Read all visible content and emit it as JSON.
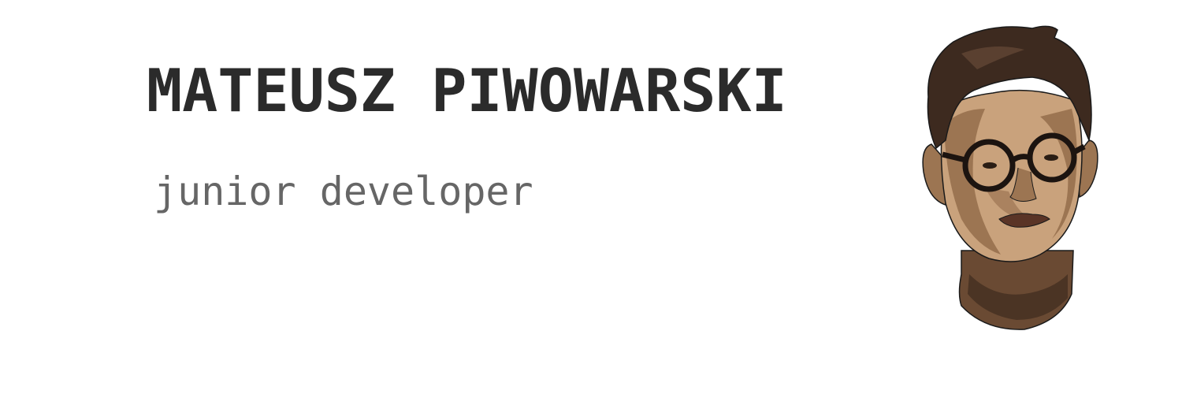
{
  "header": {
    "name": "MATEUSZ PIWOWARSKI",
    "role": "junior developer"
  },
  "portrait": {
    "icon": "person-portrait-illustration"
  },
  "colors": {
    "name_text": "#2b2b2b",
    "role_text": "#666666",
    "background": "#ffffff",
    "hair": "#3d2a1f",
    "skin_light": "#c9a27c",
    "skin_mid": "#9c7552",
    "skin_dark": "#6a4a33",
    "glasses": "#1c1410"
  }
}
